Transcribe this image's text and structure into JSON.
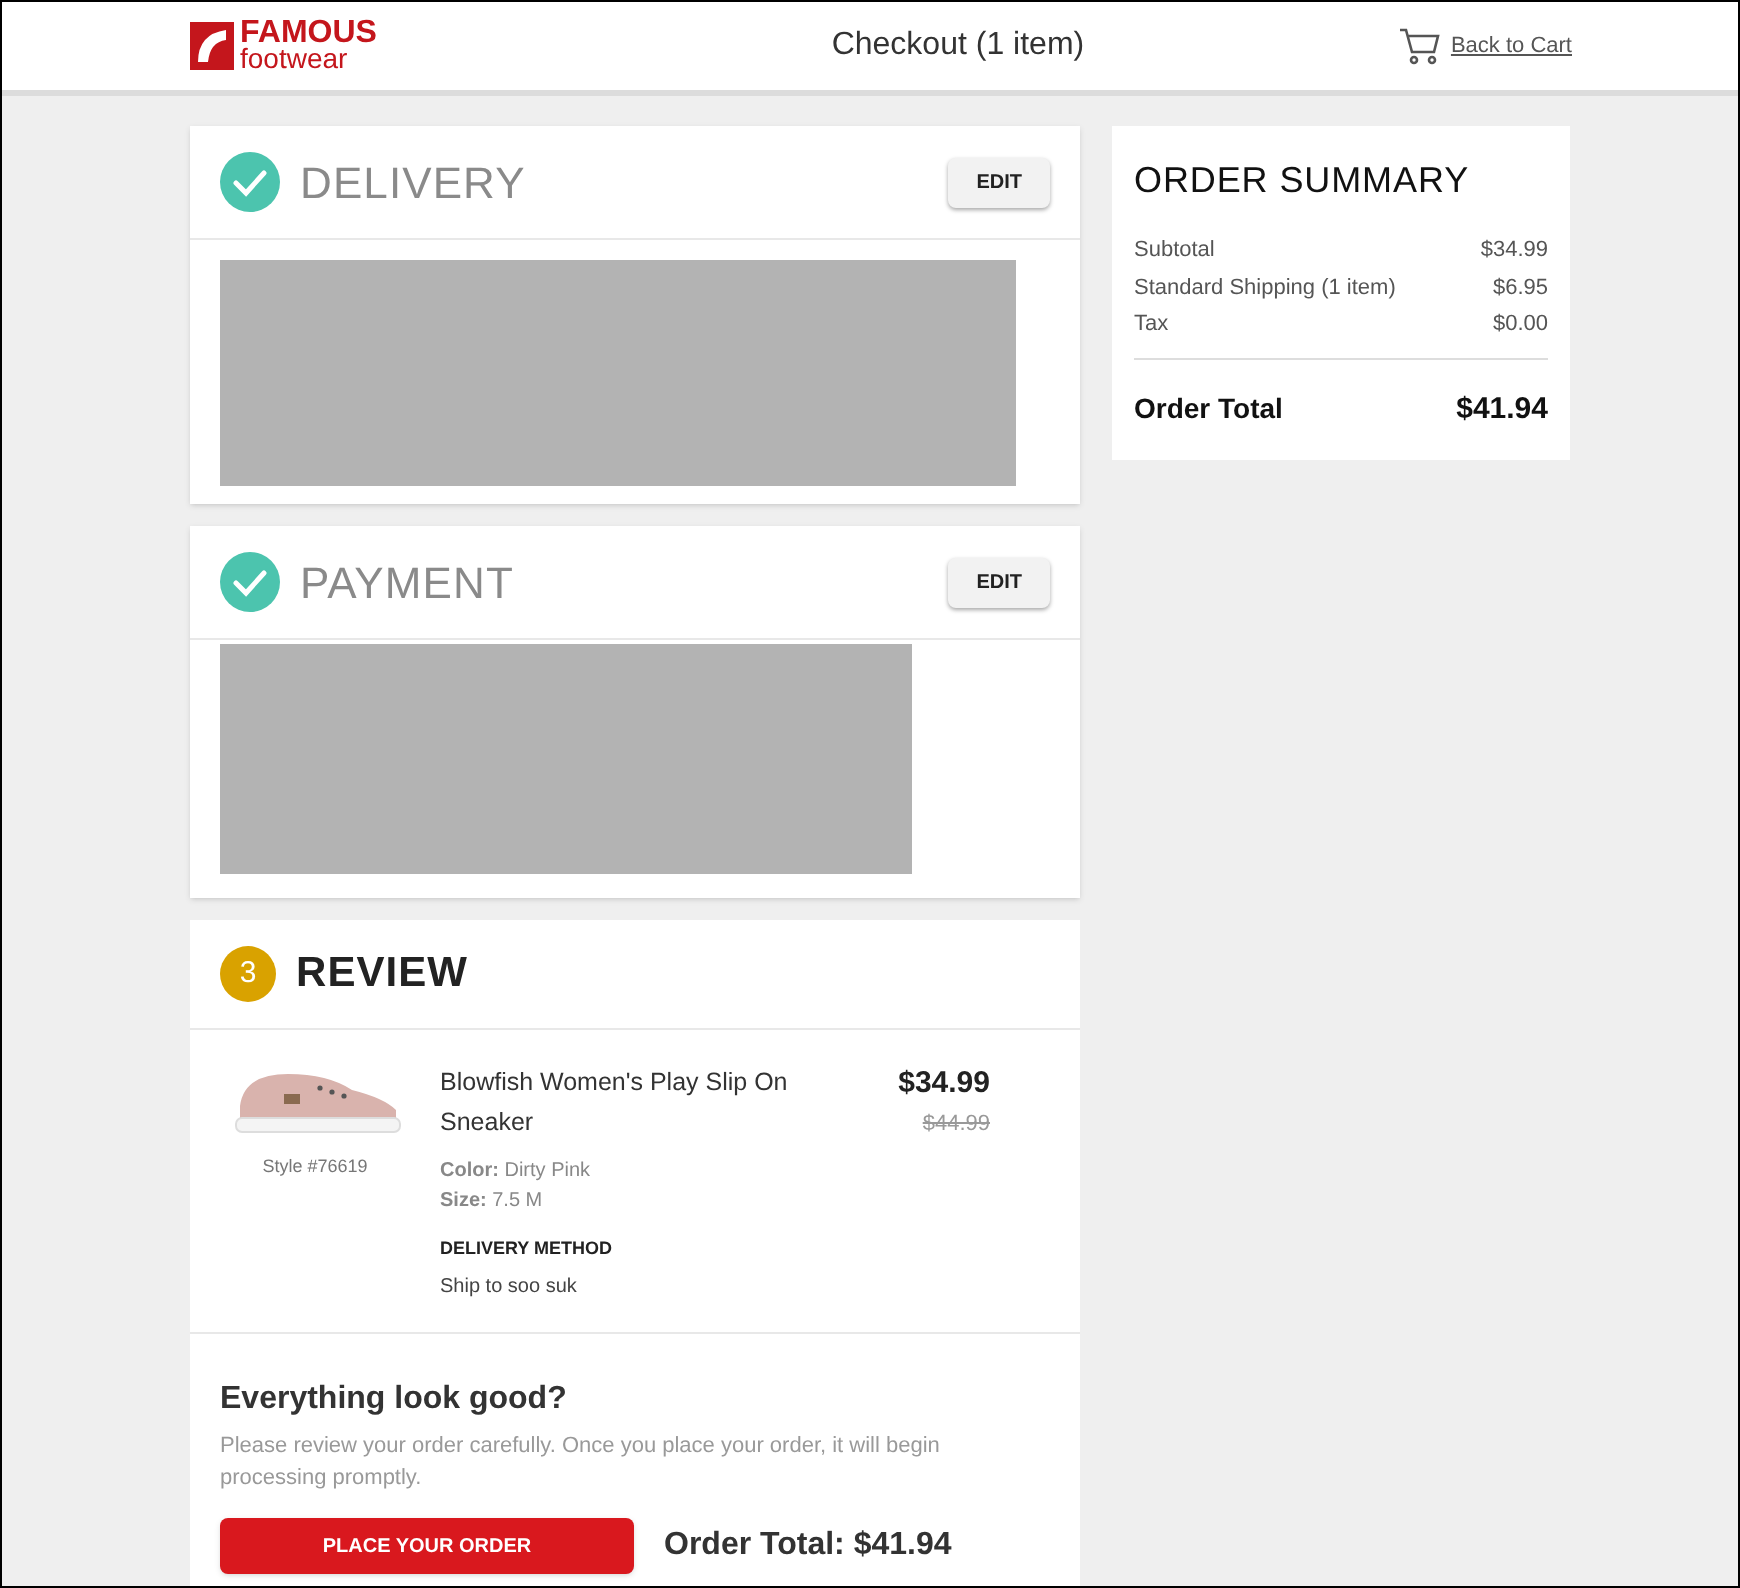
{
  "header": {
    "logo_top": "FAMOUS",
    "logo_bottom": "footwear",
    "title": "Checkout (1 item)",
    "back_link": "Back to Cart"
  },
  "sections": [
    {
      "kind": "done",
      "title": "DELIVERY",
      "edit": "EDIT"
    },
    {
      "kind": "done",
      "title": "PAYMENT",
      "edit": "EDIT"
    }
  ],
  "review": {
    "step": "3",
    "title": "REVIEW",
    "item": {
      "name": "Blowfish Women's Play Slip On Sneaker",
      "style": "Style #76619",
      "color_label": "Color:",
      "color_name": "Dirty Pink",
      "size_label": "Size:",
      "size": "7.5 M",
      "delivery_label": "DELIVERY METHOD",
      "delivery": "Ship to soo suk",
      "price": "$34.99",
      "old_price": "$44.99"
    },
    "confirm_title": "Everything look good?",
    "confirm_text": "Please review your order carefully. Once you place your order, it will begin processing promptly.",
    "place_button": "PLACE YOUR ORDER",
    "order_total": "Order Total: $41.94"
  },
  "summary": {
    "title": "ORDER SUMMARY",
    "lines": [
      {
        "label": "Subtotal",
        "value": "$34.99"
      },
      {
        "label": "Standard Shipping (1 item)",
        "value": "$6.95"
      },
      {
        "label": "Tax",
        "value": "$0.00"
      }
    ],
    "total_label": "Order Total",
    "total": "$41.94"
  }
}
